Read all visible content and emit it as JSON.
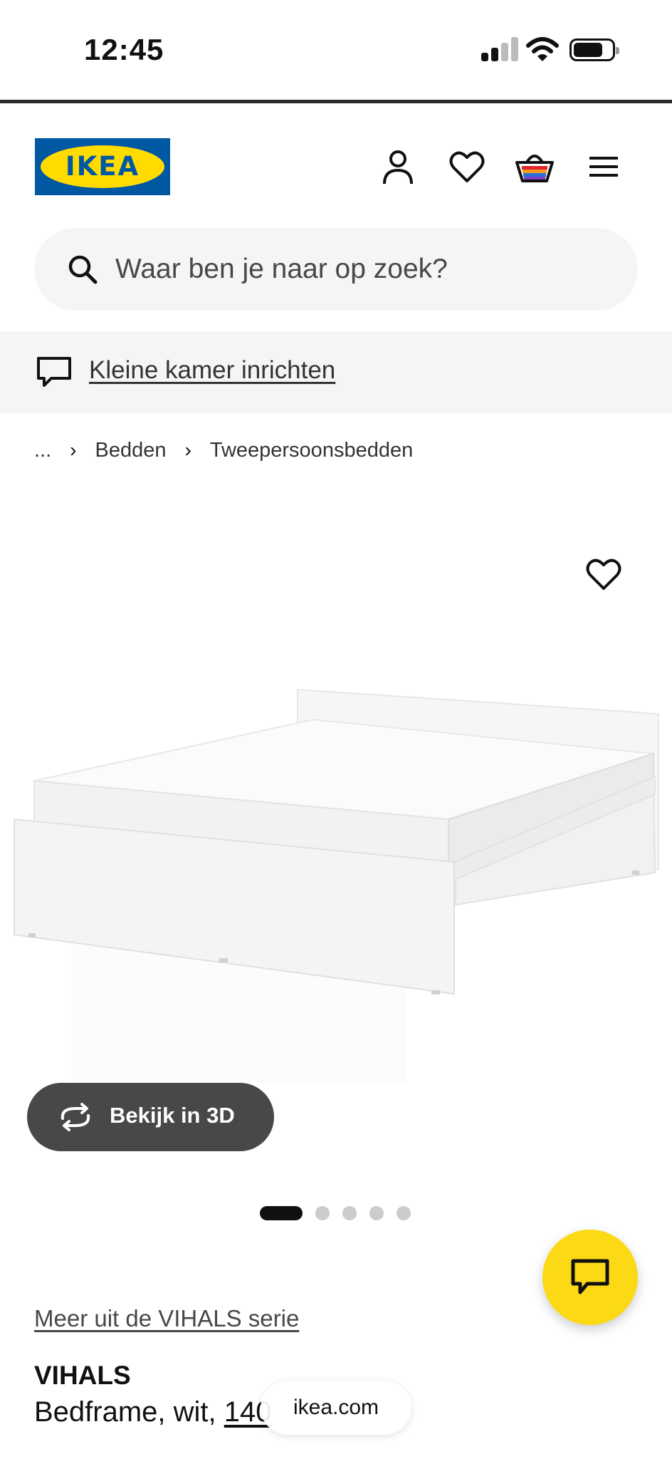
{
  "status_bar": {
    "time": "12:45"
  },
  "brand": {
    "logo_text": "IKEA",
    "blue": "#0058a3",
    "yellow": "#ffdb00"
  },
  "header": {
    "icons": [
      "account-icon",
      "wishlist-heart-icon",
      "shopping-basket-icon",
      "hamburger-menu-icon"
    ]
  },
  "search": {
    "placeholder": "Waar ben je naar op zoek?"
  },
  "promo": {
    "link_text": "Kleine kamer inrichten"
  },
  "breadcrumb": {
    "items": [
      "...",
      "Bedden",
      "Tweepersoonsbedden"
    ]
  },
  "gallery": {
    "view_3d_label": "Bekijk in 3D",
    "image_count": 5,
    "active_index": 0
  },
  "product": {
    "series_link": "Meer uit de VIHALS serie",
    "name": "VIHALS",
    "description_prefix": "Bedframe, wit, ",
    "size_link": "140"
  },
  "browser": {
    "url": "ikea.com"
  },
  "chat": {
    "accent": "#fbd914"
  }
}
